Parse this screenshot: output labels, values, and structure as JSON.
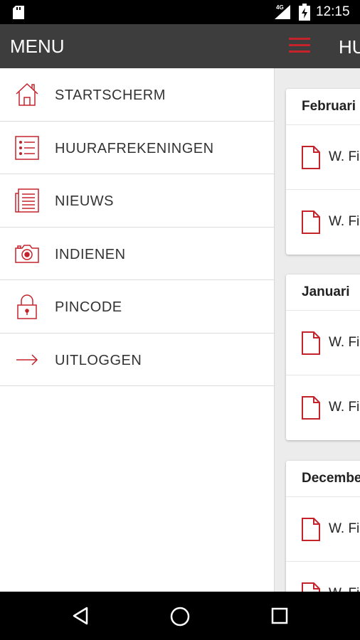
{
  "status_bar": {
    "network": "4G",
    "time": "12:15"
  },
  "drawer": {
    "title": "MENU",
    "items": [
      {
        "label": "STARTSCHERM",
        "icon": "home-icon"
      },
      {
        "label": "HUURAFREKENINGEN",
        "icon": "list-icon"
      },
      {
        "label": "NIEUWS",
        "icon": "newspaper-icon"
      },
      {
        "label": "INDIENEN",
        "icon": "camera-icon"
      },
      {
        "label": "PINCODE",
        "icon": "lock-icon"
      },
      {
        "label": "UITLOGGEN",
        "icon": "arrow-right-icon"
      }
    ]
  },
  "content": {
    "title": "HU",
    "sections": [
      {
        "header": "Februari",
        "rows": [
          "W. Fi",
          "W. Fi"
        ]
      },
      {
        "header": "Januari",
        "rows": [
          "W. Fi",
          "W. Fi"
        ]
      },
      {
        "header": "December",
        "rows": [
          "W. Fi",
          "W. Fi"
        ]
      }
    ]
  },
  "colors": {
    "accent": "#c4232c",
    "header_bg": "#3d3d3d"
  }
}
